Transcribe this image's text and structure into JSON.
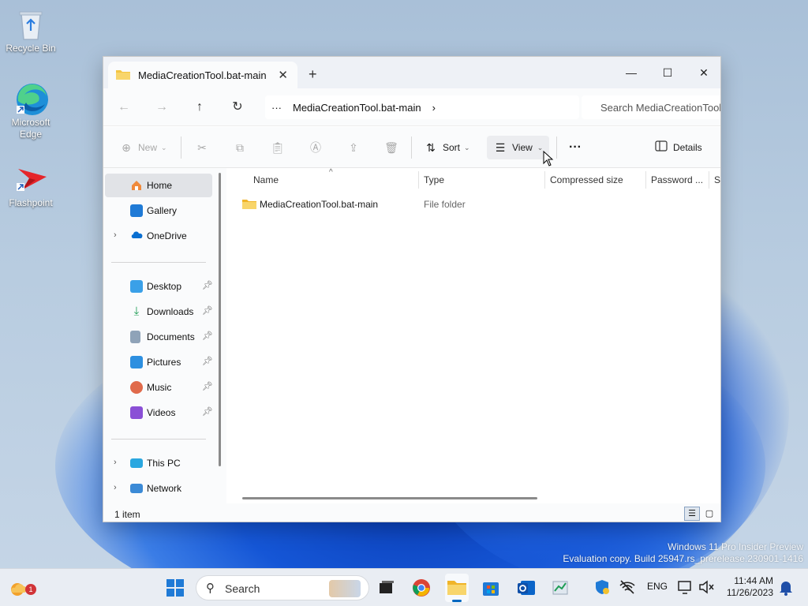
{
  "desktop": {
    "icons": [
      {
        "label": "Recycle Bin"
      },
      {
        "label": "Microsoft Edge"
      },
      {
        "label": "Flashpoint"
      }
    ],
    "watermark": {
      "line1": "Windows 11 Pro Insider Preview",
      "line2": "Evaluation copy. Build 25947.rs_prerelease.230901-1416"
    }
  },
  "window": {
    "tab_title": "MediaCreationTool.bat-main",
    "new_tab": "+",
    "minimize": "—",
    "maximize": "☐",
    "close": "✕",
    "address": {
      "overflow": "···",
      "segment": "MediaCreationTool.bat-main",
      "search_placeholder": "Search MediaCreationTool.bat-main"
    },
    "toolbar": {
      "new_label": "New",
      "sort_label": "Sort",
      "view_label": "View",
      "more_label": "···",
      "details_label": "Details"
    },
    "sidebar": {
      "quick": [
        {
          "label": "Home"
        },
        {
          "label": "Gallery"
        },
        {
          "label": "OneDrive"
        }
      ],
      "pinned": [
        {
          "label": "Desktop"
        },
        {
          "label": "Downloads"
        },
        {
          "label": "Documents"
        },
        {
          "label": "Pictures"
        },
        {
          "label": "Music"
        },
        {
          "label": "Videos"
        }
      ],
      "devices": [
        {
          "label": "This PC"
        },
        {
          "label": "Network"
        }
      ]
    },
    "columns": {
      "name": "Name",
      "type": "Type",
      "compressed": "Compressed size",
      "password": "Password ...",
      "size": "Si"
    },
    "rows": [
      {
        "name": "MediaCreationTool.bat-main",
        "type": "File folder"
      }
    ],
    "status": {
      "count": "1 item"
    }
  },
  "taskbar": {
    "search_label": "Search",
    "notification_count": "1",
    "language": "ENG",
    "time": "11:44 AM",
    "date": "11/26/2023"
  },
  "colors": {
    "accent": "#0067c0",
    "folder": "#f4c542"
  }
}
